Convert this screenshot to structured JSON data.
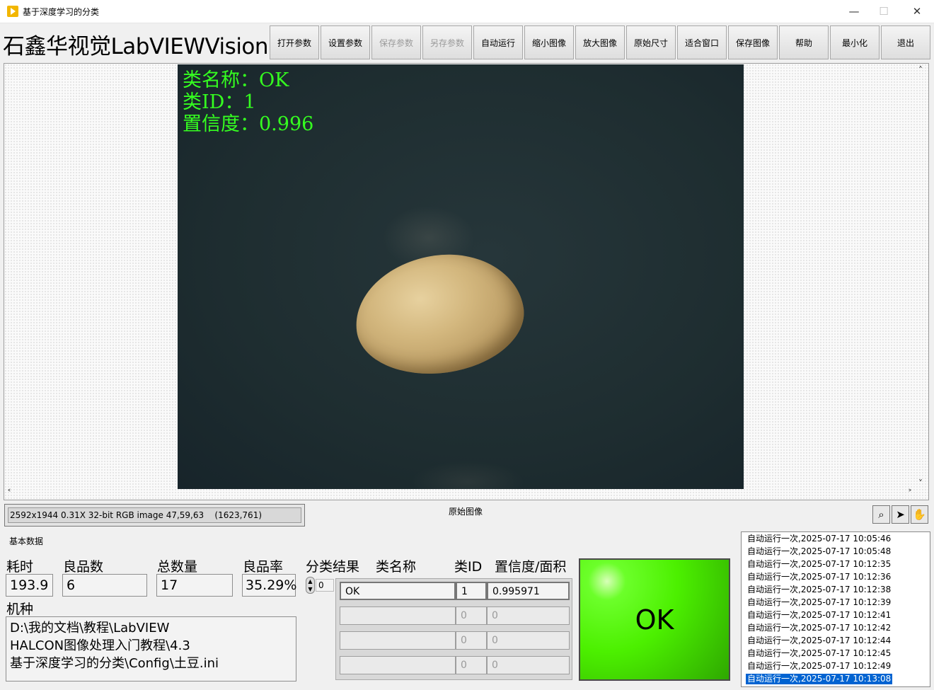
{
  "window": {
    "title": "基于深度学习的分类",
    "minimize": "—",
    "maximize": "☐",
    "close": "✕"
  },
  "header": {
    "brand": "石鑫华视觉LabVIEWVision"
  },
  "toolbar": [
    {
      "label": "打开参数",
      "enabled": true
    },
    {
      "label": "设置参数",
      "enabled": true
    },
    {
      "label": "保存参数",
      "enabled": false
    },
    {
      "label": "另存参数",
      "enabled": false
    },
    {
      "label": "自动运行",
      "enabled": true
    },
    {
      "label": "缩小图像",
      "enabled": true
    },
    {
      "label": "放大图像",
      "enabled": true
    },
    {
      "label": "原始尺寸",
      "enabled": true
    },
    {
      "label": "适合窗口",
      "enabled": true
    },
    {
      "label": "保存图像",
      "enabled": true
    },
    {
      "label": "帮助",
      "enabled": true
    },
    {
      "label": "最小化",
      "enabled": true
    },
    {
      "label": "退出",
      "enabled": true
    }
  ],
  "viewer": {
    "overlay": [
      "类名称：OK",
      "类ID：1",
      "置信度：0.996"
    ],
    "status": "2592x1944 0.31X 32-bit RGB image 47,59,63    (1623,761)",
    "caption": "原始图像",
    "tools": {
      "zoom": "⌕",
      "pointer": "➤",
      "pan": "✋"
    },
    "scroll": {
      "up": "˄",
      "down": "˅",
      "left": "˂",
      "right": "˃"
    }
  },
  "basic": {
    "section_title": "基本数据",
    "elapsed": {
      "label": "耗时",
      "value": "193.9"
    },
    "good": {
      "label": "良品数",
      "value": "6"
    },
    "total": {
      "label": "总数量",
      "value": "17"
    },
    "yield": {
      "label": "良品率",
      "value": "35.29%"
    },
    "model": {
      "label": "机种",
      "path": [
        "D:\\我的文档\\教程\\LabVIEW",
        "HALCON图像处理入门教程\\4.3",
        "基于深度学习的分类\\Config\\土豆.ini"
      ]
    }
  },
  "results": {
    "label": "分类结果",
    "index": "0",
    "columns": [
      "类名称",
      "类ID",
      "置信度/面积"
    ],
    "rows": [
      [
        "OK",
        "1",
        "0.995971"
      ],
      [
        "",
        "0",
        "0"
      ],
      [
        "",
        "0",
        "0"
      ],
      [
        "",
        "0",
        "0"
      ]
    ]
  },
  "indicator": {
    "text": "OK",
    "color": "#4cf000"
  },
  "log": {
    "entries": [
      "自动运行一次,2025-07-17 10:05:46",
      "自动运行一次,2025-07-17 10:05:48",
      "自动运行一次,2025-07-17 10:12:35",
      "自动运行一次,2025-07-17 10:12:36",
      "自动运行一次,2025-07-17 10:12:38",
      "自动运行一次,2025-07-17 10:12:39",
      "自动运行一次,2025-07-17 10:12:41",
      "自动运行一次,2025-07-17 10:12:42",
      "自动运行一次,2025-07-17 10:12:44",
      "自动运行一次,2025-07-17 10:12:45",
      "自动运行一次,2025-07-17 10:12:49",
      "自动运行一次,2025-07-17 10:13:08"
    ],
    "selected_index": 11
  }
}
